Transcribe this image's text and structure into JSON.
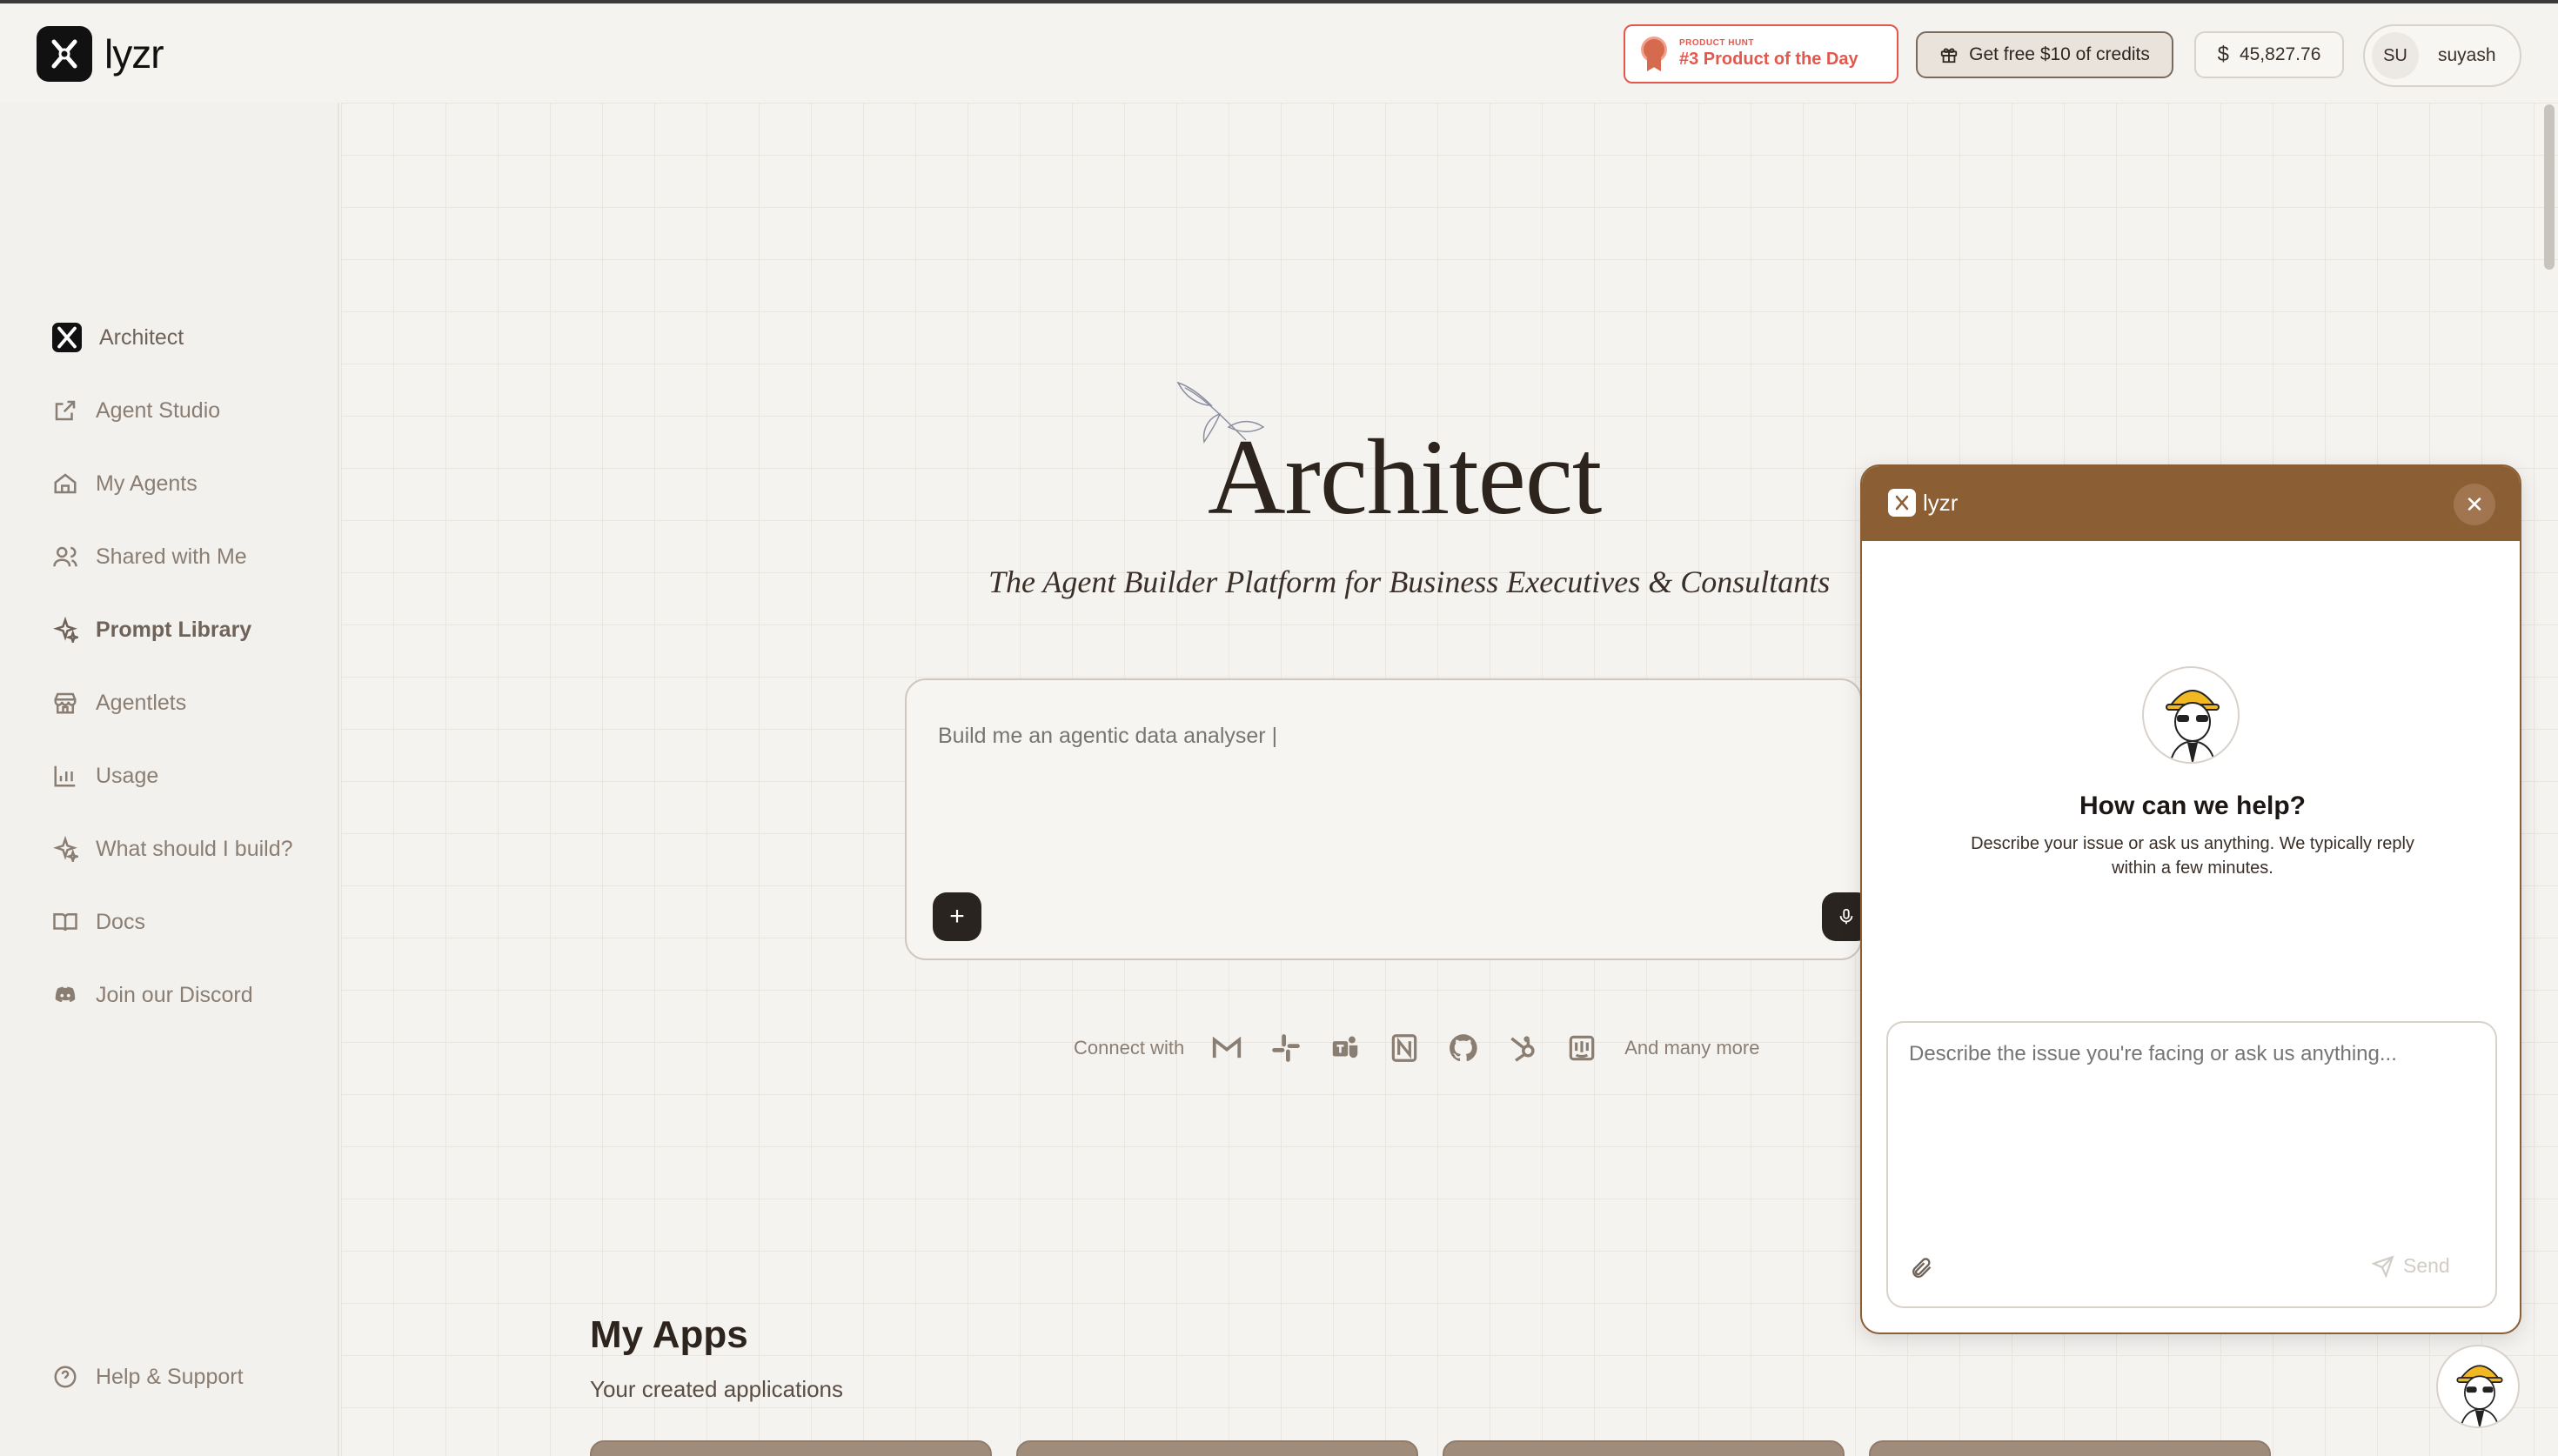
{
  "brand": {
    "name": "lyzr"
  },
  "header": {
    "product_hunt": {
      "small": "PRODUCT HUNT",
      "big": "#3 Product of the Day"
    },
    "credits_label": "Get free $10 of credits",
    "balance": "45,827.76",
    "user": {
      "initials": "SU",
      "name": "suyash"
    }
  },
  "sidebar": {
    "items": [
      {
        "label": "Architect"
      },
      {
        "label": "Agent Studio"
      },
      {
        "label": "My Agents"
      },
      {
        "label": "Shared with Me"
      },
      {
        "label": "Prompt Library"
      },
      {
        "label": "Agentlets"
      },
      {
        "label": "Usage"
      },
      {
        "label": "What should I build?"
      },
      {
        "label": "Docs"
      },
      {
        "label": "Join our Discord"
      }
    ],
    "help": "Help & Support"
  },
  "hero": {
    "title": "Architect",
    "subtitle": "The Agent Builder Platform for Business Executives & Consultants",
    "prompt_placeholder": "Build me an agentic data analyser |"
  },
  "connect": {
    "label": "Connect with",
    "more": "And many more"
  },
  "apps": {
    "title": "My Apps",
    "subtitle": "Your created applications"
  },
  "chat": {
    "brand": "lyzr",
    "question": "How can we help?",
    "description": "Describe your issue or ask us anything. We typically reply within a few minutes.",
    "input_placeholder": "Describe the issue you're facing or ask us anything...",
    "send_label": "Send"
  },
  "colors": {
    "accent": "#8b5e34",
    "product_hunt": "#e4574c",
    "dark": "#2a2420"
  }
}
